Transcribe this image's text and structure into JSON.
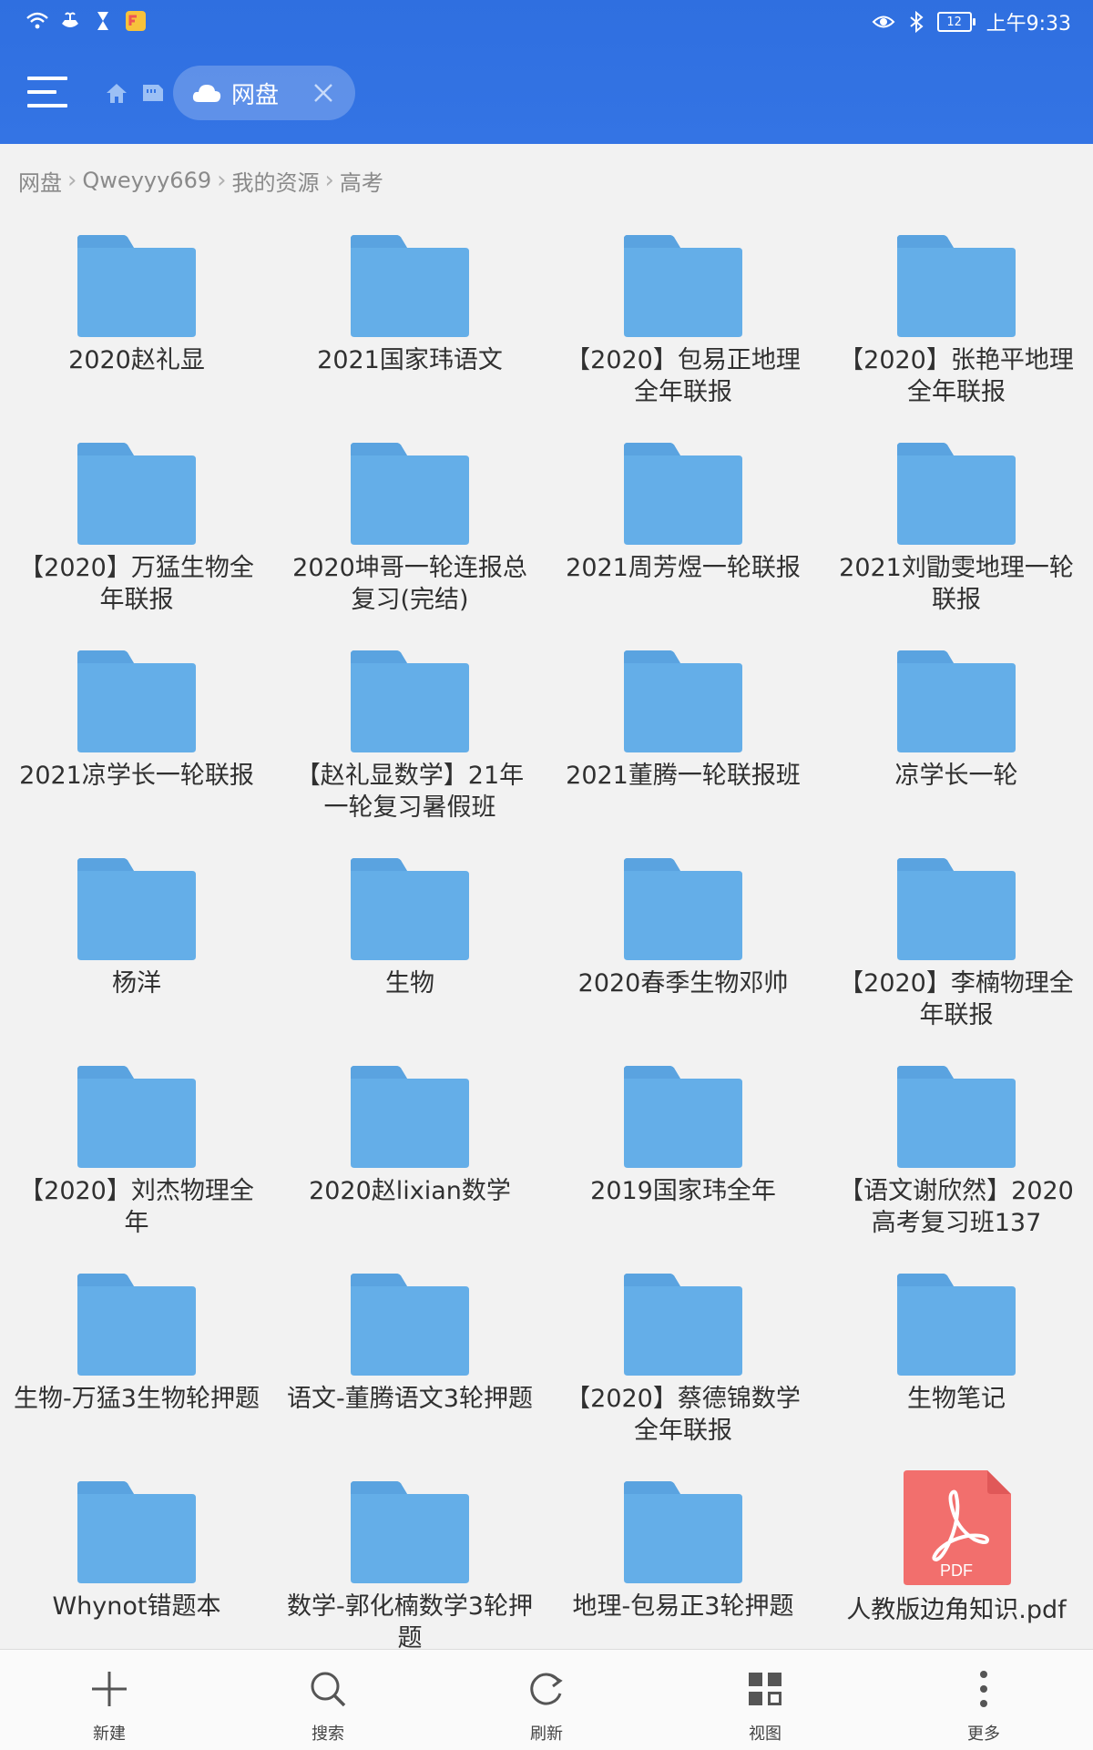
{
  "colors": {
    "header_blue": "#3474e4",
    "folder_blue": "#64aee8",
    "folder_tab": "#5aa3e0",
    "pdf_red": "#f26f6d"
  },
  "statusbar": {
    "battery": "12",
    "time": "上午9:33"
  },
  "toolbar": {
    "tab_label": "网盘"
  },
  "breadcrumb": [
    "网盘",
    "Qweyyy669",
    "我的资源",
    "高考"
  ],
  "items": [
    {
      "label": "2020赵礼显",
      "icon": "folder-icon"
    },
    {
      "label": "2021国家玮语文",
      "icon": "folder-icon"
    },
    {
      "label": "【2020】包易正地理全年联报",
      "icon": "folder-icon"
    },
    {
      "label": "【2020】张艳平地理全年联报",
      "icon": "folder-icon"
    },
    {
      "label": "【2020】万猛生物全年联报",
      "icon": "folder-icon"
    },
    {
      "label": "2020坤哥一轮连报总复习(完结)",
      "icon": "folder-icon"
    },
    {
      "label": "2021周芳煜一轮联报",
      "icon": "folder-icon"
    },
    {
      "label": "2021刘勖雯地理一轮联报",
      "icon": "folder-icon"
    },
    {
      "label": "2021凉学长一轮联报",
      "icon": "folder-icon"
    },
    {
      "label": "【赵礼显数学】21年一轮复习暑假班",
      "icon": "folder-icon"
    },
    {
      "label": "2021董腾一轮联报班",
      "icon": "folder-icon"
    },
    {
      "label": "凉学长一轮",
      "icon": "folder-icon"
    },
    {
      "label": "杨洋",
      "icon": "folder-icon"
    },
    {
      "label": "生物",
      "icon": "folder-icon"
    },
    {
      "label": "2020春季生物邓帅",
      "icon": "folder-icon"
    },
    {
      "label": "【2020】李楠物理全年联报",
      "icon": "folder-icon"
    },
    {
      "label": "【2020】刘杰物理全年",
      "icon": "folder-icon"
    },
    {
      "label": "2020赵lixian数学",
      "icon": "folder-icon"
    },
    {
      "label": "2019国家玮全年",
      "icon": "folder-icon"
    },
    {
      "label": "【语文谢欣然】2020高考复习班137",
      "icon": "folder-icon"
    },
    {
      "label": "生物-万猛3生物轮押题",
      "icon": "folder-icon"
    },
    {
      "label": "语文-董腾语文3轮押题",
      "icon": "folder-icon"
    },
    {
      "label": "【2020】蔡德锦数学全年联报",
      "icon": "folder-icon"
    },
    {
      "label": "生物笔记",
      "icon": "folder-icon"
    },
    {
      "label": "Whynot错题本",
      "icon": "folder-icon"
    },
    {
      "label": "数学-郭化楠数学3轮押题",
      "icon": "folder-icon"
    },
    {
      "label": "地理-包易正3轮押题",
      "icon": "folder-icon"
    },
    {
      "label": "人教版边角知识.pdf",
      "icon": "pdf-icon",
      "badge": "PDF"
    }
  ],
  "bottombar": [
    {
      "label": "新建",
      "icon": "plus-icon"
    },
    {
      "label": "搜索",
      "icon": "search-icon"
    },
    {
      "label": "刷新",
      "icon": "refresh-icon"
    },
    {
      "label": "视图",
      "icon": "grid-view-icon"
    },
    {
      "label": "更多",
      "icon": "more-icon"
    }
  ]
}
